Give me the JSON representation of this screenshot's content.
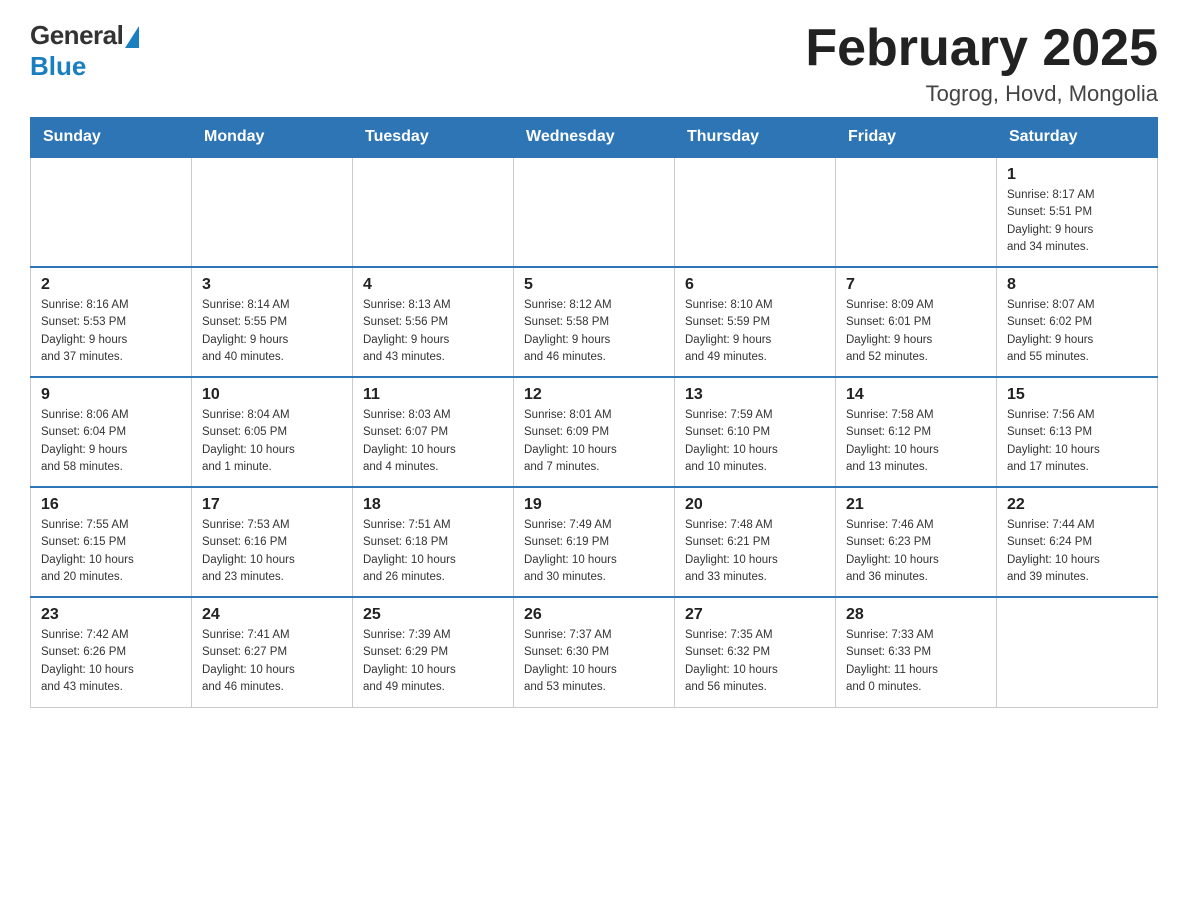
{
  "header": {
    "logo": {
      "general": "General",
      "blue": "Blue"
    },
    "title": "February 2025",
    "location": "Togrog, Hovd, Mongolia"
  },
  "weekdays": [
    "Sunday",
    "Monday",
    "Tuesday",
    "Wednesday",
    "Thursday",
    "Friday",
    "Saturday"
  ],
  "weeks": [
    [
      {
        "day": "",
        "info": ""
      },
      {
        "day": "",
        "info": ""
      },
      {
        "day": "",
        "info": ""
      },
      {
        "day": "",
        "info": ""
      },
      {
        "day": "",
        "info": ""
      },
      {
        "day": "",
        "info": ""
      },
      {
        "day": "1",
        "info": "Sunrise: 8:17 AM\nSunset: 5:51 PM\nDaylight: 9 hours\nand 34 minutes."
      }
    ],
    [
      {
        "day": "2",
        "info": "Sunrise: 8:16 AM\nSunset: 5:53 PM\nDaylight: 9 hours\nand 37 minutes."
      },
      {
        "day": "3",
        "info": "Sunrise: 8:14 AM\nSunset: 5:55 PM\nDaylight: 9 hours\nand 40 minutes."
      },
      {
        "day": "4",
        "info": "Sunrise: 8:13 AM\nSunset: 5:56 PM\nDaylight: 9 hours\nand 43 minutes."
      },
      {
        "day": "5",
        "info": "Sunrise: 8:12 AM\nSunset: 5:58 PM\nDaylight: 9 hours\nand 46 minutes."
      },
      {
        "day": "6",
        "info": "Sunrise: 8:10 AM\nSunset: 5:59 PM\nDaylight: 9 hours\nand 49 minutes."
      },
      {
        "day": "7",
        "info": "Sunrise: 8:09 AM\nSunset: 6:01 PM\nDaylight: 9 hours\nand 52 minutes."
      },
      {
        "day": "8",
        "info": "Sunrise: 8:07 AM\nSunset: 6:02 PM\nDaylight: 9 hours\nand 55 minutes."
      }
    ],
    [
      {
        "day": "9",
        "info": "Sunrise: 8:06 AM\nSunset: 6:04 PM\nDaylight: 9 hours\nand 58 minutes."
      },
      {
        "day": "10",
        "info": "Sunrise: 8:04 AM\nSunset: 6:05 PM\nDaylight: 10 hours\nand 1 minute."
      },
      {
        "day": "11",
        "info": "Sunrise: 8:03 AM\nSunset: 6:07 PM\nDaylight: 10 hours\nand 4 minutes."
      },
      {
        "day": "12",
        "info": "Sunrise: 8:01 AM\nSunset: 6:09 PM\nDaylight: 10 hours\nand 7 minutes."
      },
      {
        "day": "13",
        "info": "Sunrise: 7:59 AM\nSunset: 6:10 PM\nDaylight: 10 hours\nand 10 minutes."
      },
      {
        "day": "14",
        "info": "Sunrise: 7:58 AM\nSunset: 6:12 PM\nDaylight: 10 hours\nand 13 minutes."
      },
      {
        "day": "15",
        "info": "Sunrise: 7:56 AM\nSunset: 6:13 PM\nDaylight: 10 hours\nand 17 minutes."
      }
    ],
    [
      {
        "day": "16",
        "info": "Sunrise: 7:55 AM\nSunset: 6:15 PM\nDaylight: 10 hours\nand 20 minutes."
      },
      {
        "day": "17",
        "info": "Sunrise: 7:53 AM\nSunset: 6:16 PM\nDaylight: 10 hours\nand 23 minutes."
      },
      {
        "day": "18",
        "info": "Sunrise: 7:51 AM\nSunset: 6:18 PM\nDaylight: 10 hours\nand 26 minutes."
      },
      {
        "day": "19",
        "info": "Sunrise: 7:49 AM\nSunset: 6:19 PM\nDaylight: 10 hours\nand 30 minutes."
      },
      {
        "day": "20",
        "info": "Sunrise: 7:48 AM\nSunset: 6:21 PM\nDaylight: 10 hours\nand 33 minutes."
      },
      {
        "day": "21",
        "info": "Sunrise: 7:46 AM\nSunset: 6:23 PM\nDaylight: 10 hours\nand 36 minutes."
      },
      {
        "day": "22",
        "info": "Sunrise: 7:44 AM\nSunset: 6:24 PM\nDaylight: 10 hours\nand 39 minutes."
      }
    ],
    [
      {
        "day": "23",
        "info": "Sunrise: 7:42 AM\nSunset: 6:26 PM\nDaylight: 10 hours\nand 43 minutes."
      },
      {
        "day": "24",
        "info": "Sunrise: 7:41 AM\nSunset: 6:27 PM\nDaylight: 10 hours\nand 46 minutes."
      },
      {
        "day": "25",
        "info": "Sunrise: 7:39 AM\nSunset: 6:29 PM\nDaylight: 10 hours\nand 49 minutes."
      },
      {
        "day": "26",
        "info": "Sunrise: 7:37 AM\nSunset: 6:30 PM\nDaylight: 10 hours\nand 53 minutes."
      },
      {
        "day": "27",
        "info": "Sunrise: 7:35 AM\nSunset: 6:32 PM\nDaylight: 10 hours\nand 56 minutes."
      },
      {
        "day": "28",
        "info": "Sunrise: 7:33 AM\nSunset: 6:33 PM\nDaylight: 11 hours\nand 0 minutes."
      },
      {
        "day": "",
        "info": ""
      }
    ]
  ]
}
